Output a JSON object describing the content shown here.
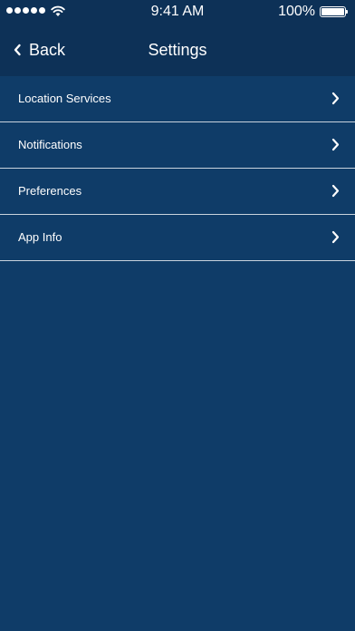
{
  "status_bar": {
    "time": "9:41 AM",
    "battery_percent": "100%",
    "battery_level": 1.0,
    "signal_bars": 5,
    "icons": [
      "signal-icon",
      "wifi-icon",
      "battery-icon"
    ]
  },
  "nav": {
    "back_label": "Back",
    "title": "Settings",
    "back_icon": "chevron-left-icon"
  },
  "settings": {
    "items": [
      {
        "label": "Location Services",
        "icon": "chevron-right-icon"
      },
      {
        "label": "Notifications",
        "icon": "chevron-right-icon"
      },
      {
        "label": "Preferences",
        "icon": "chevron-right-icon"
      },
      {
        "label": "App Info",
        "icon": "chevron-right-icon"
      }
    ]
  },
  "colors": {
    "background": "#0f3c68",
    "header_background": "#0d3157",
    "separator": "#c9d3dd",
    "text": "#ffffff"
  }
}
